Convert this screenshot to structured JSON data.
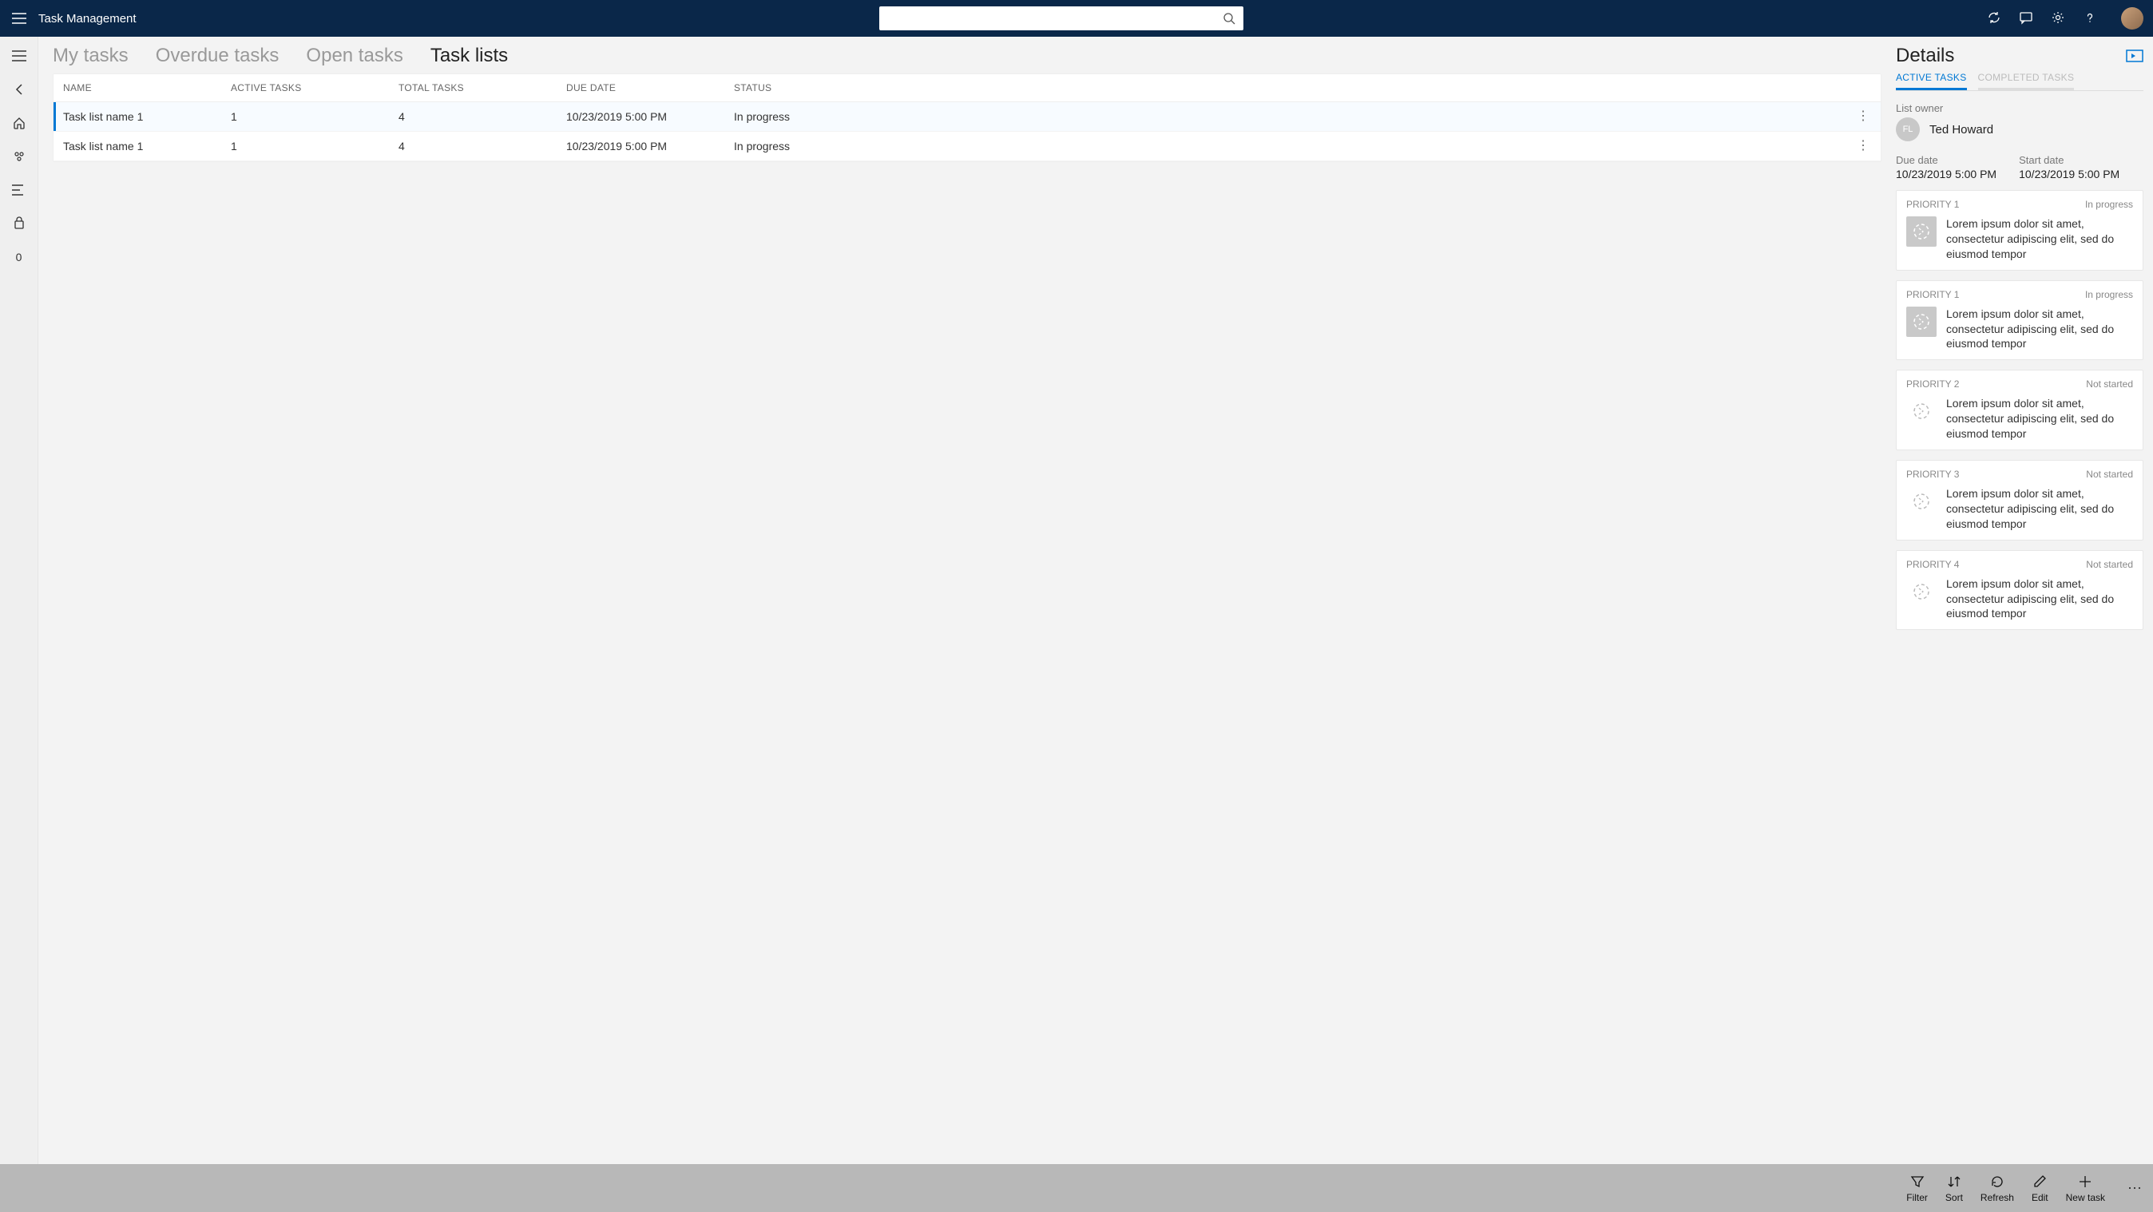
{
  "app_title": "Task Management",
  "search_placeholder": "",
  "tabs": [
    "My tasks",
    "Overdue tasks",
    "Open tasks",
    "Task lists"
  ],
  "active_tab_index": 3,
  "table": {
    "headers": {
      "name": "NAME",
      "active": "ACTIVE TASKS",
      "total": "TOTAL TASKS",
      "due": "DUE DATE",
      "status": "STATUS"
    },
    "rows": [
      {
        "name": "Task list name 1",
        "active": "1",
        "total": "4",
        "due": "10/23/2019 5:00 PM",
        "status": "In progress",
        "selected": true
      },
      {
        "name": "Task list name 1",
        "active": "1",
        "total": "4",
        "due": "10/23/2019 5:00 PM",
        "status": "In progress",
        "selected": false
      }
    ]
  },
  "details": {
    "title": "Details",
    "tabs": [
      "ACTIVE TASKS",
      "COMPLETED TASKS"
    ],
    "active_tab_index": 0,
    "owner_label": "List owner",
    "owner_monogram": "FL",
    "owner_name": "Ted Howard",
    "due_label": "Due date",
    "due_value": "10/23/2019 5:00 PM",
    "start_label": "Start date",
    "start_value": "10/23/2019 5:00 PM",
    "tasks": [
      {
        "priority": "PRIORITY 1",
        "status": "In progress",
        "thumb": "filled",
        "text": "Lorem ipsum dolor sit amet, consectetur adipiscing elit, sed do eiusmod tempor"
      },
      {
        "priority": "PRIORITY 1",
        "status": "In progress",
        "thumb": "filled",
        "text": "Lorem ipsum dolor sit amet, consectetur adipiscing elit, sed do eiusmod tempor"
      },
      {
        "priority": "PRIORITY 2",
        "status": "Not started",
        "thumb": "open",
        "text": "Lorem ipsum dolor sit amet, consectetur adipiscing elit, sed do eiusmod tempor"
      },
      {
        "priority": "PRIORITY 3",
        "status": "Not started",
        "thumb": "open",
        "text": "Lorem ipsum dolor sit amet, consectetur adipiscing elit, sed do eiusmod tempor"
      },
      {
        "priority": "PRIORITY 4",
        "status": "Not started",
        "thumb": "open",
        "text": "Lorem ipsum dolor sit amet, consectetur adipiscing elit, sed do eiusmod tempor"
      }
    ]
  },
  "commandbar": {
    "filter": "Filter",
    "sort": "Sort",
    "refresh": "Refresh",
    "edit": "Edit",
    "newtask": "New task"
  }
}
